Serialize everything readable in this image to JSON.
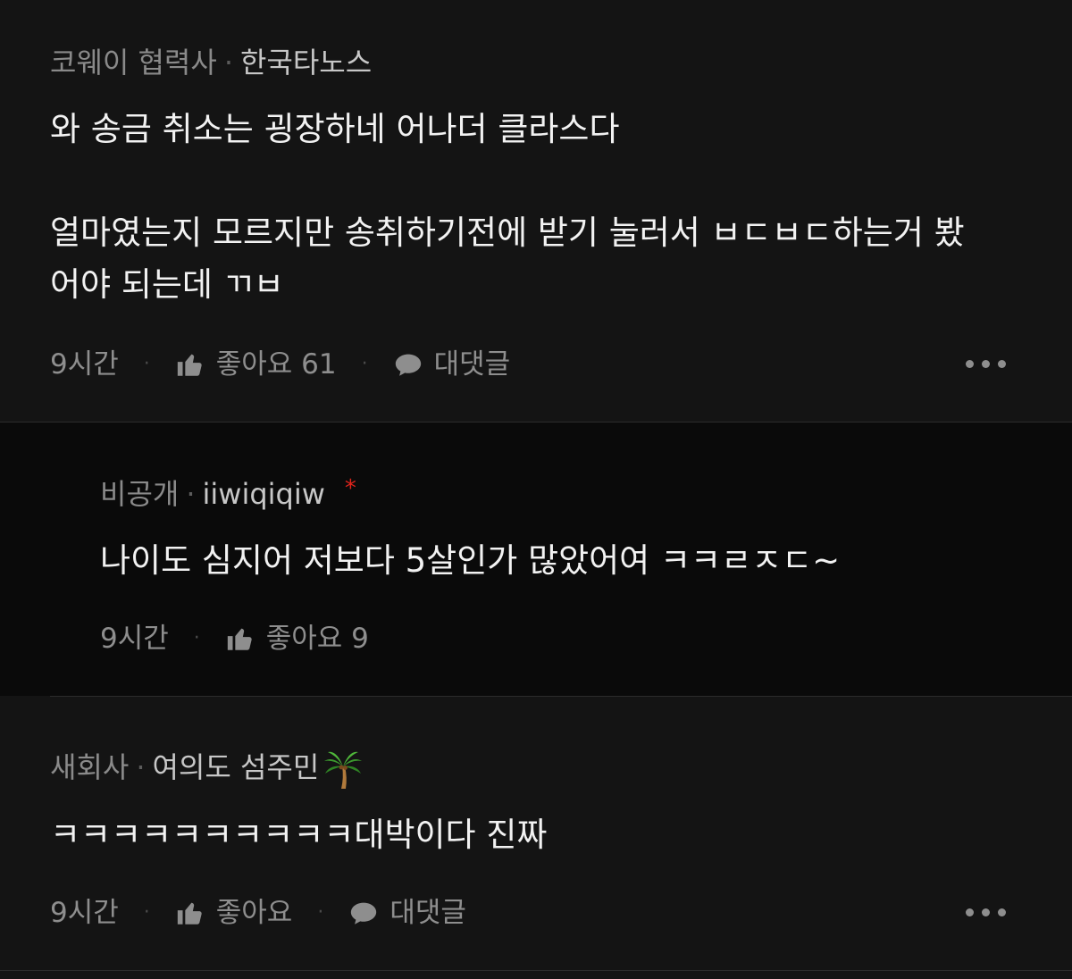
{
  "comments": [
    {
      "company": "코웨이 협력사",
      "separator": "·",
      "nickname": "한국타노스",
      "lines": [
        "와 송금 취소는 굉장하네 어나더 클라스다",
        "",
        "얼마였는지 모르지만 송취하기전에 받기 눌러서 ㅂㄷㅂㄷ하는거 봤",
        "어야 되는데 ㄲㅂ"
      ],
      "time": "9시간",
      "like_label": "좋아요 61",
      "reply_label": "대댓글"
    },
    {
      "company": "비공개",
      "separator": "·",
      "nickname": "iiwiqiqiw",
      "author_mark": "*",
      "lines": [
        "나이도 심지어 저보다 5살인가 많았어여 ㅋㅋㄹㅈㄷ~"
      ],
      "time": "9시간",
      "like_label": "좋아요 9"
    },
    {
      "company": "새회사",
      "separator": "·",
      "nickname": "여의도 섬주민",
      "nickname_emoji": "palm-tree",
      "lines": [
        "ㅋㅋㅋㅋㅋㅋㅋㅋㅋㅋ대박이다 진짜"
      ],
      "time": "9시간",
      "like_label": "좋아요",
      "reply_label": "대댓글"
    }
  ],
  "dot_separator": "·",
  "colors": {
    "background": "#141414",
    "reply_background": "#0a0a0a",
    "text_primary": "#f2f2f2",
    "text_secondary": "#8e8e8e",
    "nickname": "#c7c7c7",
    "author_mark": "#e0241b"
  },
  "icons": [
    "thumbs-up-icon",
    "speech-bubble-icon",
    "more-options-icon",
    "palm-tree-emoji"
  ]
}
